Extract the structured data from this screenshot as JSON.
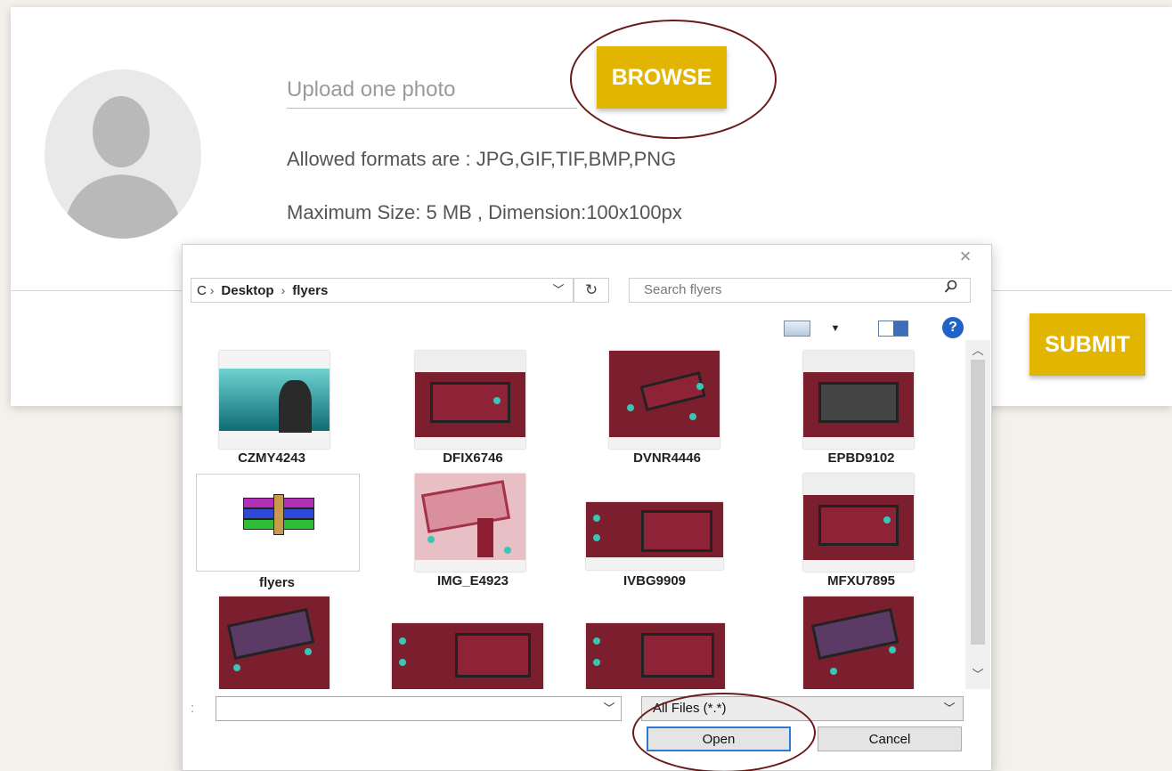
{
  "form": {
    "upload_placeholder": "Upload one photo",
    "browse_label": "BROWSE",
    "allowed_formats": "Allowed formats are :  JPG,GIF,TIF,BMP,PNG",
    "max_size": "Maximum Size:  5 MB  ,  Dimension:100x100px",
    "submit_label": "SUBMIT"
  },
  "dialog": {
    "close_glyph": "×",
    "breadcrumb": {
      "leading": "C",
      "items": [
        "Desktop",
        "flyers"
      ]
    },
    "search_placeholder": "Search flyers",
    "files": [
      {
        "name": "CZMY4243"
      },
      {
        "name": "DFIX6746"
      },
      {
        "name": "DVNR4446"
      },
      {
        "name": "EPBD9102"
      },
      {
        "name": "flyers"
      },
      {
        "name": "IMG_E4923"
      },
      {
        "name": "IVBG9909"
      },
      {
        "name": "MFXU7895"
      }
    ],
    "filename_label": ":",
    "filename_value": "",
    "filetype_value": "All Files (*.*)",
    "open_label": "Open",
    "cancel_label": "Cancel"
  },
  "colors": {
    "accent_yellow": "#e3b503",
    "annotation_oval": "#6b1a1a",
    "thumb_maroon": "#7b1e2e",
    "help_blue": "#1f63c7"
  }
}
